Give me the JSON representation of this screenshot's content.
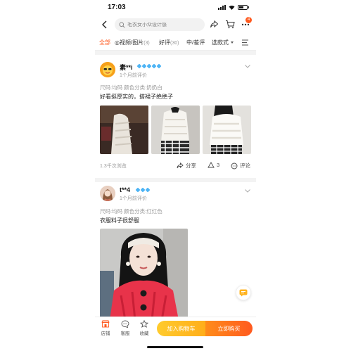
{
  "status": {
    "time": "17:03"
  },
  "search": {
    "placeholder": "毛衣女小众设计感"
  },
  "header": {
    "more_badge": "4"
  },
  "filters": {
    "all": "全部",
    "video_label": "◎视频/图片",
    "video_count": "(3)",
    "good_label": "好评",
    "good_count": "(30)",
    "mid_label": "中/差评",
    "sort_label": "选款式"
  },
  "reviews": [
    {
      "username": "素**i",
      "diamond_count": 5,
      "time": "1个月前评价",
      "sku": "尺码:均码 颜色分类:奶奶白",
      "text": "好看挺厚实的，搭裙子绝绝子",
      "views": "1.3千次浏览",
      "share_label": "分享",
      "like_count": "3",
      "comment_label": "评论"
    },
    {
      "username": "t**4",
      "diamond_count": 3,
      "time": "1个月前评价",
      "sku": "尺码:均码 颜色分类:红红色",
      "text": "衣服料子很舒服"
    }
  ],
  "bottom": {
    "store": "店铺",
    "service": "客服",
    "favorite": "收藏",
    "add_cart": "加入购物车",
    "buy_now": "立即购买"
  },
  "colors": {
    "accent": "#ff5a1f",
    "diamond": "#4db4f5",
    "cart_button": "#ffb31f",
    "buy_button": "#ff6a1f"
  }
}
